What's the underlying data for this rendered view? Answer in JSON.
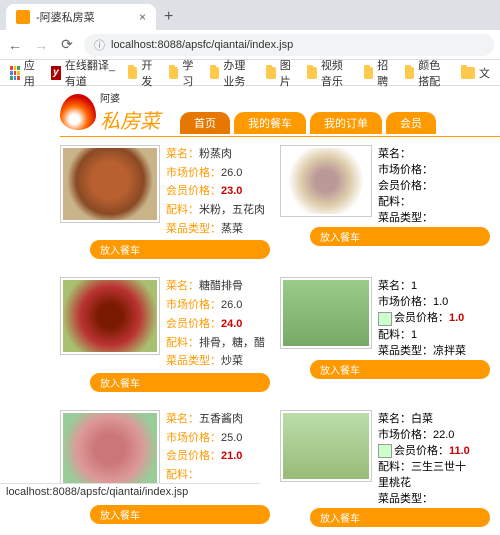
{
  "browser": {
    "tab_title": "-阿婆私房菜",
    "url": "localhost:8088/apsfc/qiantai/index.jsp",
    "status_bar": "localhost:8088/apsfc/qiantai/index.jsp"
  },
  "bookmarks": {
    "apps": "应用",
    "y_label": "在线翻译_有道",
    "items": [
      "开发",
      "学习",
      "办理业务",
      "图片",
      "视频音乐",
      "招聘",
      "颜色搭配",
      "文"
    ]
  },
  "site": {
    "brand_small": "阿婆",
    "brand": "私房菜",
    "nav": [
      "首页",
      "我的餐车",
      "我的订单",
      "会员"
    ]
  },
  "labels": {
    "name": "菜名：",
    "market": "市场价格：",
    "member": "会员价格：",
    "ingredients": "配料：",
    "type": "菜品类型：",
    "add_cart": "放入餐车"
  },
  "dishes": [
    {
      "name": "粉蒸肉",
      "market": "26.0",
      "member": "23.0",
      "ingredients": "米粉，五花肉",
      "type": "蒸菜",
      "img": {
        "bg": "radial-gradient(circle at 50% 45%,#b86030 30%,#8a4a24 55%,#c9b48a 70%)"
      }
    },
    {
      "name": "",
      "market": "",
      "member": "",
      "ingredients": "",
      "type": "",
      "img": {
        "bg": "radial-gradient(circle at 50% 50%,#b99 20%,#dca 45%,#fff 70%)"
      }
    },
    {
      "name": "糖醋排骨",
      "market": "26.0",
      "member": "24.0",
      "ingredients": "排骨，糖，醋",
      "type": "炒菜",
      "img": {
        "bg": "radial-gradient(circle at 50% 50%,#7a1a00 20%,#b33 50%,#a8c070 80%)"
      }
    },
    {
      "name": "1",
      "market": "1.0",
      "member": "1.0",
      "ingredients": "1",
      "type": "凉拌菜",
      "img": {
        "bg": "linear-gradient(#9c8,#7a6)"
      }
    },
    {
      "name": "五香酱肉",
      "market": "25.0",
      "member": "21.0",
      "ingredients": "",
      "type": "",
      "img": {
        "bg": "radial-gradient(circle at 50% 50%,#c77 25%,#d99 55%,#9c9 80%)"
      }
    },
    {
      "name": "白菜",
      "market": "22.0",
      "member": "11.0",
      "ingredients": "三生三世十里桃花",
      "type": "",
      "img": {
        "bg": "linear-gradient(#bda,#9b7)"
      }
    }
  ]
}
